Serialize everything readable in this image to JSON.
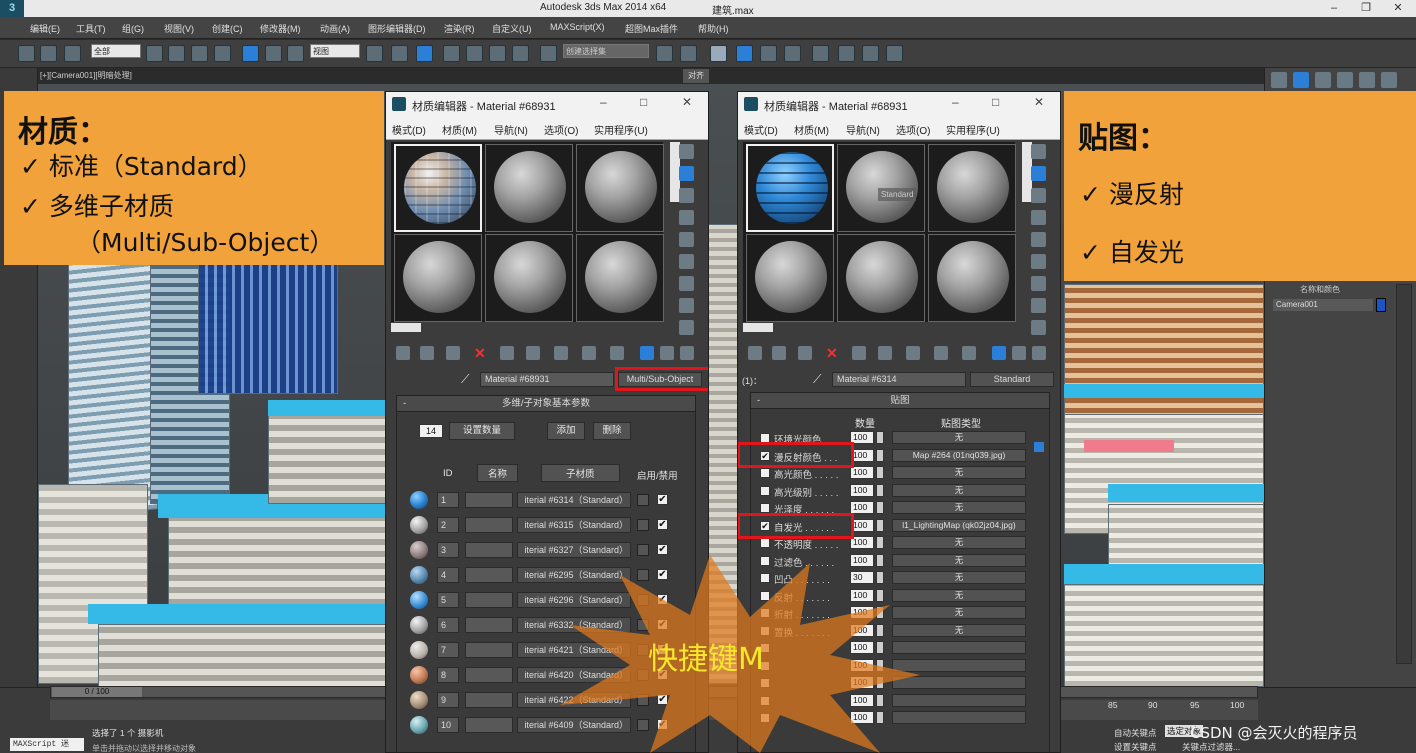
{
  "app": {
    "title": "Autodesk 3ds Max  2014 x64",
    "file": "建筑.max"
  },
  "menubar": [
    "编辑(E)",
    "工具(T)",
    "组(G)",
    "视图(V)",
    "创建(C)",
    "修改器(M)",
    "动画(A)",
    "图形编辑器(D)",
    "渲染(R)",
    "自定义(U)",
    "MAXScript(X)",
    "超图Max插件",
    "帮助(H)"
  ],
  "toolbar": {
    "selection_filter": "全部",
    "ref_coord": "视图",
    "named_selection": "创建选择集",
    "tooltip": "对齐"
  },
  "viewport": {
    "label": "[+][Camera001][明暗处理]"
  },
  "annotations": {
    "left": {
      "heading": "材质：",
      "items": [
        "✓  标准（Standard）",
        "✓  多维子材质",
        "（Multi/Sub-Object）"
      ]
    },
    "right": {
      "heading": "贴图：",
      "items": [
        "✓  漫反射",
        "✓  自发光"
      ]
    },
    "shortcut": "快捷键M"
  },
  "editor1": {
    "title": "材质编辑器 - Material #68931",
    "menu": [
      "模式(D)",
      "材质(M)",
      "导航(N)",
      "选项(O)",
      "实用程序(U)"
    ],
    "material_name": "Material #68931",
    "material_type": "Multi/Sub-Object",
    "rollout_title": "多维/子对象基本参数",
    "count": "14",
    "btn_set_count": "设置数量",
    "btn_add": "添加",
    "btn_delete": "删除",
    "col_id": "ID",
    "col_name": "名称",
    "col_submaterial": "子材质",
    "col_onoff": "启用/禁用",
    "rows": [
      {
        "id": "1",
        "sub": "iterial #6314（Standard）"
      },
      {
        "id": "2",
        "sub": "iterial #6315（Standard）"
      },
      {
        "id": "3",
        "sub": "iterial #6327（Standard）"
      },
      {
        "id": "4",
        "sub": "iterial #6295（Standard）"
      },
      {
        "id": "5",
        "sub": "iterial #6296（Standard）"
      },
      {
        "id": "6",
        "sub": "iterial #6332（Standard）"
      },
      {
        "id": "7",
        "sub": "iterial #6421（Standard）"
      },
      {
        "id": "8",
        "sub": "iterial #6420（Standard）"
      },
      {
        "id": "9",
        "sub": "iterial #6422（Standard）"
      },
      {
        "id": "10",
        "sub": "iterial #6409（Standard）"
      }
    ]
  },
  "editor2": {
    "title": "材质编辑器 - Material #68931",
    "menu": [
      "模式(D)",
      "材质(M)",
      "导航(N)",
      "选项(O)",
      "实用程序(U)"
    ],
    "level": "(1)：",
    "material_name": "Material #6314",
    "material_type": "Standard",
    "slot_tooltip": "Standard",
    "rollout_title": "贴图",
    "col_amount": "数量",
    "col_maptype": "贴图类型",
    "rows": [
      {
        "label": "环境光颜色",
        "amount": "100",
        "map": "无",
        "checked": false
      },
      {
        "label": "漫反射颜色 . . .",
        "amount": "100",
        "map": "Map #264 (01nq039.jpg)",
        "checked": true
      },
      {
        "label": "高光颜色 . . . . .",
        "amount": "100",
        "map": "无",
        "checked": false
      },
      {
        "label": "高光级别 . . . . .",
        "amount": "100",
        "map": "无",
        "checked": false
      },
      {
        "label": "光泽度 . . . . . .",
        "amount": "100",
        "map": "无",
        "checked": false
      },
      {
        "label": "自发光 . . . . . .",
        "amount": "100",
        "map": "l1_LightingMap (qk02jz04.jpg)",
        "checked": true
      },
      {
        "label": "不透明度 . . . . .",
        "amount": "100",
        "map": "无",
        "checked": false
      },
      {
        "label": "过滤色 . . . . . .",
        "amount": "100",
        "map": "无",
        "checked": false
      },
      {
        "label": "凹凸 . . . . . . .",
        "amount": "30",
        "map": "无",
        "checked": false
      },
      {
        "label": "反射 . . . . . . .",
        "amount": "100",
        "map": "无",
        "checked": false
      },
      {
        "label": "折射 . . . . . . .",
        "amount": "100",
        "map": "无",
        "checked": false
      },
      {
        "label": "置换 . . . . . . .",
        "amount": "100",
        "map": "无",
        "checked": false
      },
      {
        "label": "",
        "amount": "100",
        "map": "",
        "checked": false
      },
      {
        "label": "",
        "amount": "100",
        "map": "",
        "checked": false
      },
      {
        "label": "",
        "amount": "100",
        "map": "",
        "checked": false
      },
      {
        "label": "",
        "amount": "100",
        "map": "",
        "checked": false
      },
      {
        "label": "",
        "amount": "100",
        "map": "",
        "checked": false
      }
    ]
  },
  "right_panel": {
    "heading": "名称和颜色",
    "object_name": "Camera001",
    "object_color": "#1a55c4"
  },
  "status": {
    "time": "0 / 100",
    "script": "MAXScript 迷",
    "line1": "选择了 1 个 摄影机",
    "line2": "单击并拖动以选择并移动对象",
    "autokey": "自动关键点",
    "setkey": "设置关键点",
    "selected": "选定对象",
    "keyfilter": "关键点过滤器...",
    "ticks": [
      "85",
      "90",
      "95",
      "100"
    ]
  },
  "watermark": "CSDN @会灭火的程序员"
}
